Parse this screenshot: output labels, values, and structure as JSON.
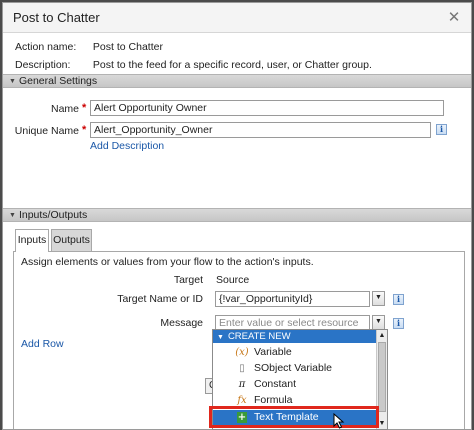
{
  "dialog": {
    "title": "Post to Chatter",
    "close_icon": "close-icon"
  },
  "info": {
    "action_label": "Action name:",
    "action_value": "Post to Chatter",
    "description_label": "Description:",
    "description_value": "Post to the feed for a specific record, user, or Chatter group."
  },
  "general": {
    "title": "General Settings",
    "name_label": "Name",
    "name_value": "Alert Opportunity Owner",
    "unique_label": "Unique Name",
    "unique_value": "Alert_Opportunity_Owner",
    "add_description": "Add Description",
    "required_mark": "*",
    "info_glyph": "i"
  },
  "io": {
    "title": "Inputs/Outputs",
    "tabs": [
      {
        "label": "Inputs",
        "active": true
      },
      {
        "label": "Outputs",
        "active": false
      }
    ],
    "instructions": "Assign elements or values from your flow to the action's inputs.",
    "target_header": "Target",
    "source_header": "Source",
    "rows": [
      {
        "target": "Target Name or ID",
        "source": "{!var_OpportunityId}",
        "placeholder": ""
      },
      {
        "target": "Message",
        "source": "",
        "placeholder": "Enter value or select resource"
      }
    ],
    "add_row": "Add Row",
    "info_glyph": "i"
  },
  "dropdown": {
    "header": "CREATE NEW",
    "items": [
      {
        "label": "Variable",
        "icon": "variable-icon",
        "glyph": "(x)"
      },
      {
        "label": "SObject Variable",
        "icon": "sobject-variable-icon",
        "glyph": "▯"
      },
      {
        "label": "Constant",
        "icon": "constant-icon",
        "glyph": "π"
      },
      {
        "label": "Formula",
        "icon": "formula-icon",
        "glyph": "fx"
      },
      {
        "label": "Text Template",
        "icon": "text-template-icon",
        "glyph": "+"
      }
    ],
    "selected_index": 4
  },
  "colors": {
    "accent_blue": "#2a74c6",
    "link_blue": "#1a57a7",
    "highlight_red": "#e0271c",
    "required_red": "#cc0000"
  }
}
